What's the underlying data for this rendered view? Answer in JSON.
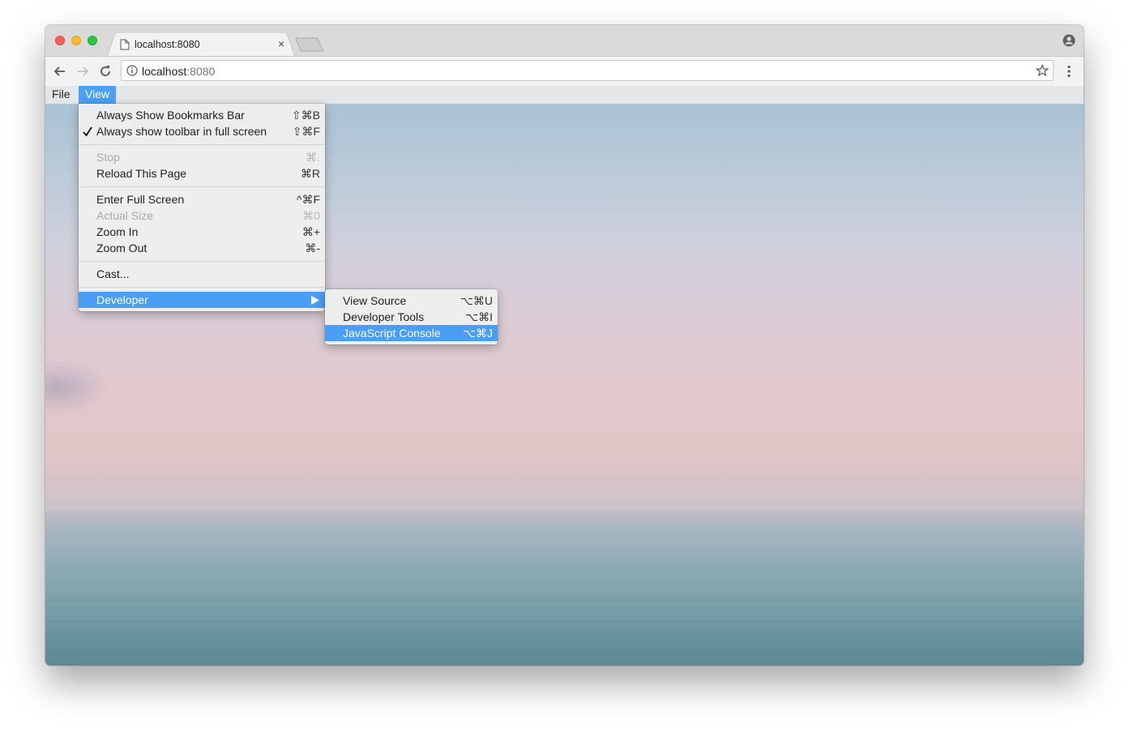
{
  "tab": {
    "title": "localhost:8080",
    "close": "×"
  },
  "address_bar": {
    "host": "localhost",
    "port": ":8080"
  },
  "menubar": {
    "items": [
      "File",
      "View"
    ],
    "active": "View"
  },
  "view_menu": {
    "items": [
      {
        "label": "Always Show Bookmarks Bar",
        "shortcut": "⇧⌘B",
        "enabled": true,
        "checked": false
      },
      {
        "label": "Always show toolbar in full screen",
        "shortcut": "⇧⌘F",
        "enabled": true,
        "checked": true
      },
      {
        "label": "Stop",
        "shortcut": "⌘.",
        "enabled": false
      },
      {
        "label": "Reload This Page",
        "shortcut": "⌘R",
        "enabled": true
      },
      {
        "label": "Enter Full Screen",
        "shortcut": "^⌘F",
        "enabled": true
      },
      {
        "label": "Actual Size",
        "shortcut": "⌘0",
        "enabled": false
      },
      {
        "label": "Zoom In",
        "shortcut": "⌘+",
        "enabled": true
      },
      {
        "label": "Zoom Out",
        "shortcut": "⌘-",
        "enabled": true
      },
      {
        "label": "Cast...",
        "enabled": true
      },
      {
        "label": "Developer",
        "enabled": true,
        "highlighted": true,
        "has_submenu": true
      }
    ]
  },
  "developer_submenu": {
    "items": [
      {
        "label": "View Source",
        "shortcut": "⌥⌘U"
      },
      {
        "label": "Developer Tools",
        "shortcut": "⌥⌘I"
      },
      {
        "label": "JavaScript Console",
        "shortcut": "⌥⌘J",
        "highlighted": true
      }
    ]
  },
  "icons": {
    "check": "check-icon",
    "submenu_arrow": "triangle-right-icon",
    "page": "page-icon",
    "info": "info-icon",
    "star": "star-icon",
    "menu": "kebab-icon",
    "profile": "profile-icon"
  },
  "colors": {
    "highlight": "#4a9ef5",
    "traffic_close": "#fc5f57",
    "traffic_min": "#fdbc2e",
    "traffic_max": "#28c840"
  }
}
